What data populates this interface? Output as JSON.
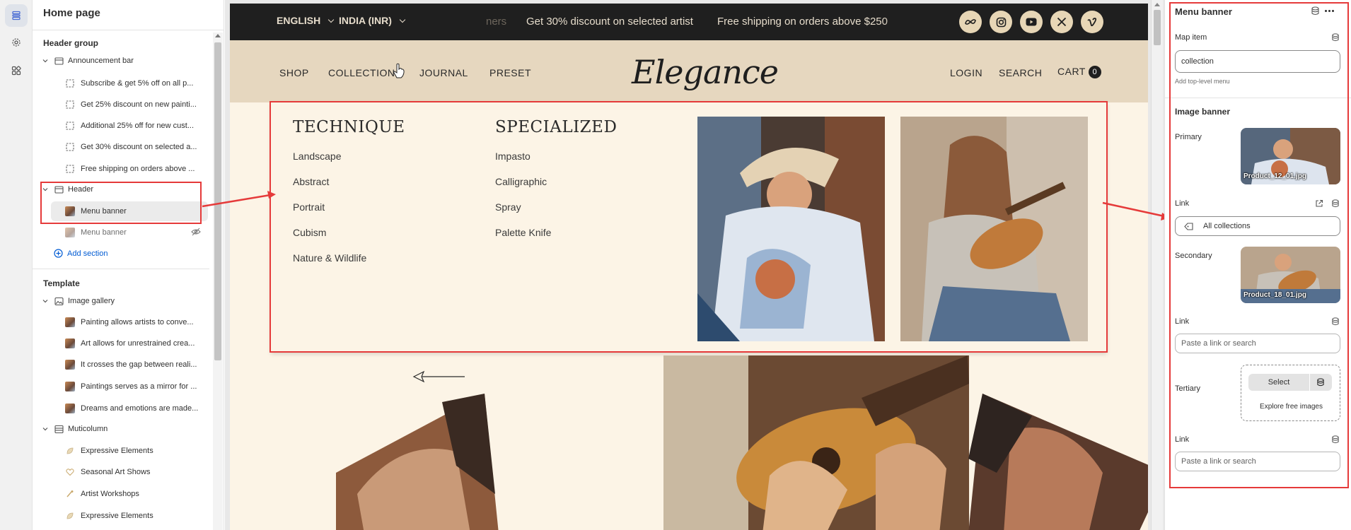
{
  "sidebar": {
    "title": "Home page",
    "header_group": {
      "heading": "Header group",
      "announcement_bar": {
        "label": "Announcement bar",
        "items": [
          "Subscribe & get 5% off on all p...",
          "Get 25% discount on new painti...",
          "Additional 25% off for new cust...",
          "Get 30% discount on selected a...",
          "Free shipping on orders above ..."
        ]
      },
      "header": {
        "label": "Header",
        "items": [
          "Menu banner",
          "Menu banner"
        ]
      },
      "add_section": "Add section"
    },
    "template": {
      "heading": "Template",
      "image_gallery": {
        "label": "Image gallery",
        "items": [
          "Painting allows artists to conve...",
          "Art allows for unrestrained crea...",
          "It crosses the gap between reali...",
          "Paintings serves as a mirror for ...",
          "Dreams and emotions are made..."
        ]
      },
      "multicolumn": {
        "label": "Muticolumn",
        "items": [
          "Expressive Elements",
          "Seasonal Art Shows",
          "Artist Workshops",
          "Expressive Elements"
        ]
      }
    }
  },
  "preview": {
    "topbar": {
      "language": "ENGLISH",
      "currency": "INDIA (INR)",
      "ticker_prev": "ners",
      "ticker_1": "Get 30% discount on selected artist",
      "ticker_2": "Free shipping on orders above $250"
    },
    "social": [
      "meta-icon",
      "instagram-icon",
      "youtube-icon",
      "x-icon",
      "vimeo-icon"
    ],
    "nav": {
      "left": [
        "SHOP",
        "COLLECTION",
        "JOURNAL",
        "PRESET"
      ],
      "logo": "Elegance",
      "right": [
        "LOGIN",
        "SEARCH",
        "CART"
      ],
      "cart_count": "0"
    },
    "mega_menu": {
      "col1": {
        "heading": "TECHNIQUE",
        "links": [
          "Landscape",
          "Abstract",
          "Portrait",
          "Cubism",
          "Nature & Wildlife"
        ]
      },
      "col2": {
        "heading": "SPECIALIZED",
        "links": [
          "Impasto",
          "Calligraphic",
          "Spray",
          "Palette Knife"
        ]
      }
    }
  },
  "panel": {
    "title": "Menu banner",
    "map_item": {
      "label": "Map item",
      "value": "collection",
      "hint": "Add top-level menu"
    },
    "image_banner": {
      "heading": "Image banner",
      "primary": {
        "label": "Primary",
        "file": "Product_12_01.jpg"
      },
      "primary_link": {
        "label": "Link",
        "value": "All collections"
      },
      "secondary": {
        "label": "Secondary",
        "file": "Product_18_01.jpg"
      },
      "secondary_link": {
        "label": "Link",
        "placeholder": "Paste a link or search"
      },
      "tertiary": {
        "label": "Tertiary",
        "select": "Select",
        "explore": "Explore free images"
      },
      "tertiary_link": {
        "label": "Link",
        "placeholder": "Paste a link or search"
      }
    }
  },
  "colors": {
    "highlight": "#e53a3a",
    "topbar": "#1f1f1f",
    "nav_bg": "#e6d7bf",
    "page_bg": "#fcf4e6",
    "link_blue": "#005bd3"
  }
}
